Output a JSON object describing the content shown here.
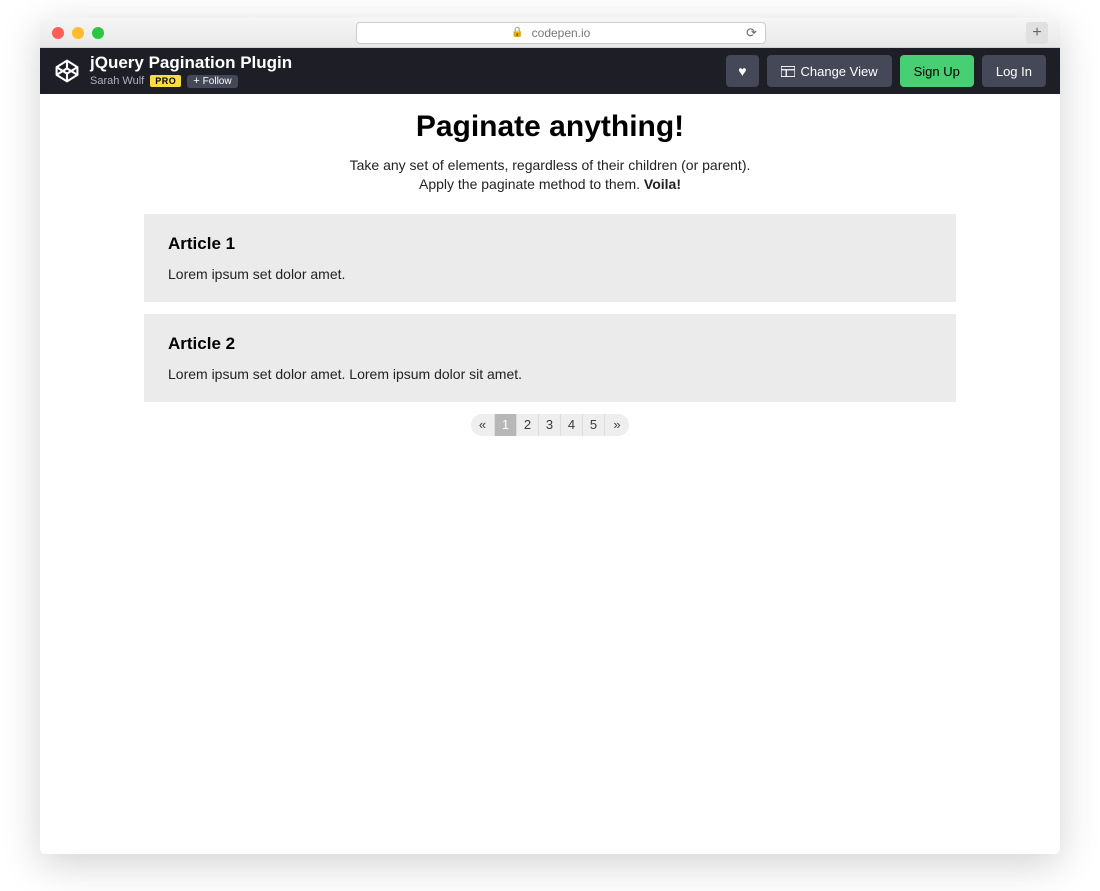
{
  "browser": {
    "url": "codepen.io"
  },
  "header": {
    "title": "jQuery Pagination Plugin",
    "author": "Sarah Wulf",
    "pro_label": "PRO",
    "follow_label": "Follow",
    "change_view_label": "Change View",
    "signup_label": "Sign Up",
    "login_label": "Log In"
  },
  "page": {
    "title": "Paginate anything!",
    "desc_line1": "Take any set of elements, regardless of their children (or parent).",
    "desc_line2_prefix": "Apply the paginate method to them. ",
    "desc_line2_bold": "Voila!"
  },
  "articles": [
    {
      "title": "Article 1",
      "body": "Lorem ipsum set dolor amet."
    },
    {
      "title": "Article 2",
      "body": "Lorem ipsum set dolor amet. Lorem ipsum dolor sit amet."
    }
  ],
  "pagination": {
    "prev": "«",
    "next": "»",
    "pages": [
      "1",
      "2",
      "3",
      "4",
      "5"
    ],
    "active_index": 0
  }
}
